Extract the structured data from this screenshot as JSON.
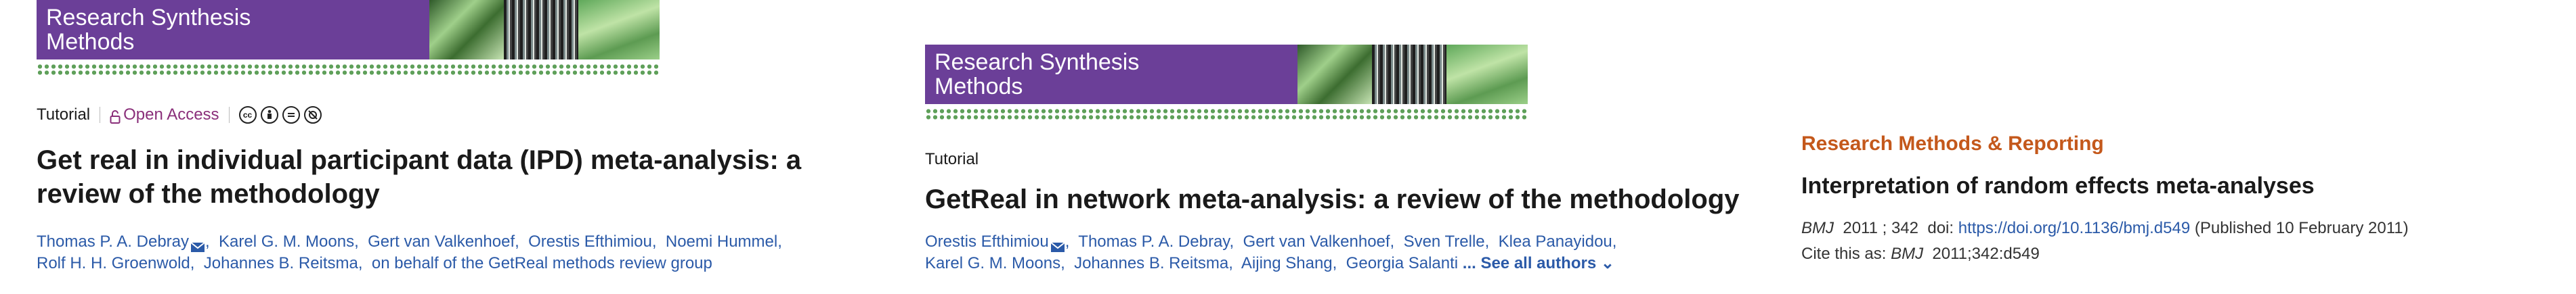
{
  "panel1": {
    "journal_logo": "Research Synthesis Methods",
    "article_type": "Tutorial",
    "access": "Open Access",
    "license_icons": [
      "cc-icon",
      "by-icon",
      "nc-icon",
      "nd-icon"
    ],
    "title": "Get real in individual participant data (IPD) meta-analysis: a review of the methodology",
    "authors": [
      "Thomas P. A. Debray",
      "Karel G. M. Moons,",
      "Gert van Valkenhoef,",
      "Orestis Efthimiou,",
      "Noemi Hummel,",
      "Rolf H. H. Groenwold,",
      "Johannes B. Reitsma,",
      "on behalf of the GetReal methods review group"
    ]
  },
  "panel2": {
    "journal_logo": "Research Synthesis Methods",
    "article_type": "Tutorial",
    "title": "GetReal in network meta-analysis: a review of the methodology",
    "authors": [
      "Orestis Efthimiou",
      "Thomas P. A. Debray,",
      "Gert van Valkenhoef,",
      "Sven Trelle,",
      "Klea Panayidou,",
      "Karel G. M. Moons,",
      "Johannes B. Reitsma,",
      "Aijing Shang,",
      "Georgia Salanti"
    ],
    "see_all": "... See all authors"
  },
  "panel3": {
    "section": "Research Methods & Reporting",
    "title": "Interpretation of random effects meta-analyses",
    "journal": "BMJ",
    "volume": "2011 ; 342",
    "doi_label": "doi:",
    "doi_link": "https://doi.org/10.1136/bmj.d549",
    "published": "(Published 10 February 2011)",
    "cite_label": "Cite this as:",
    "cite_journal": "BMJ",
    "cite_ref": "2011;342:d549"
  }
}
